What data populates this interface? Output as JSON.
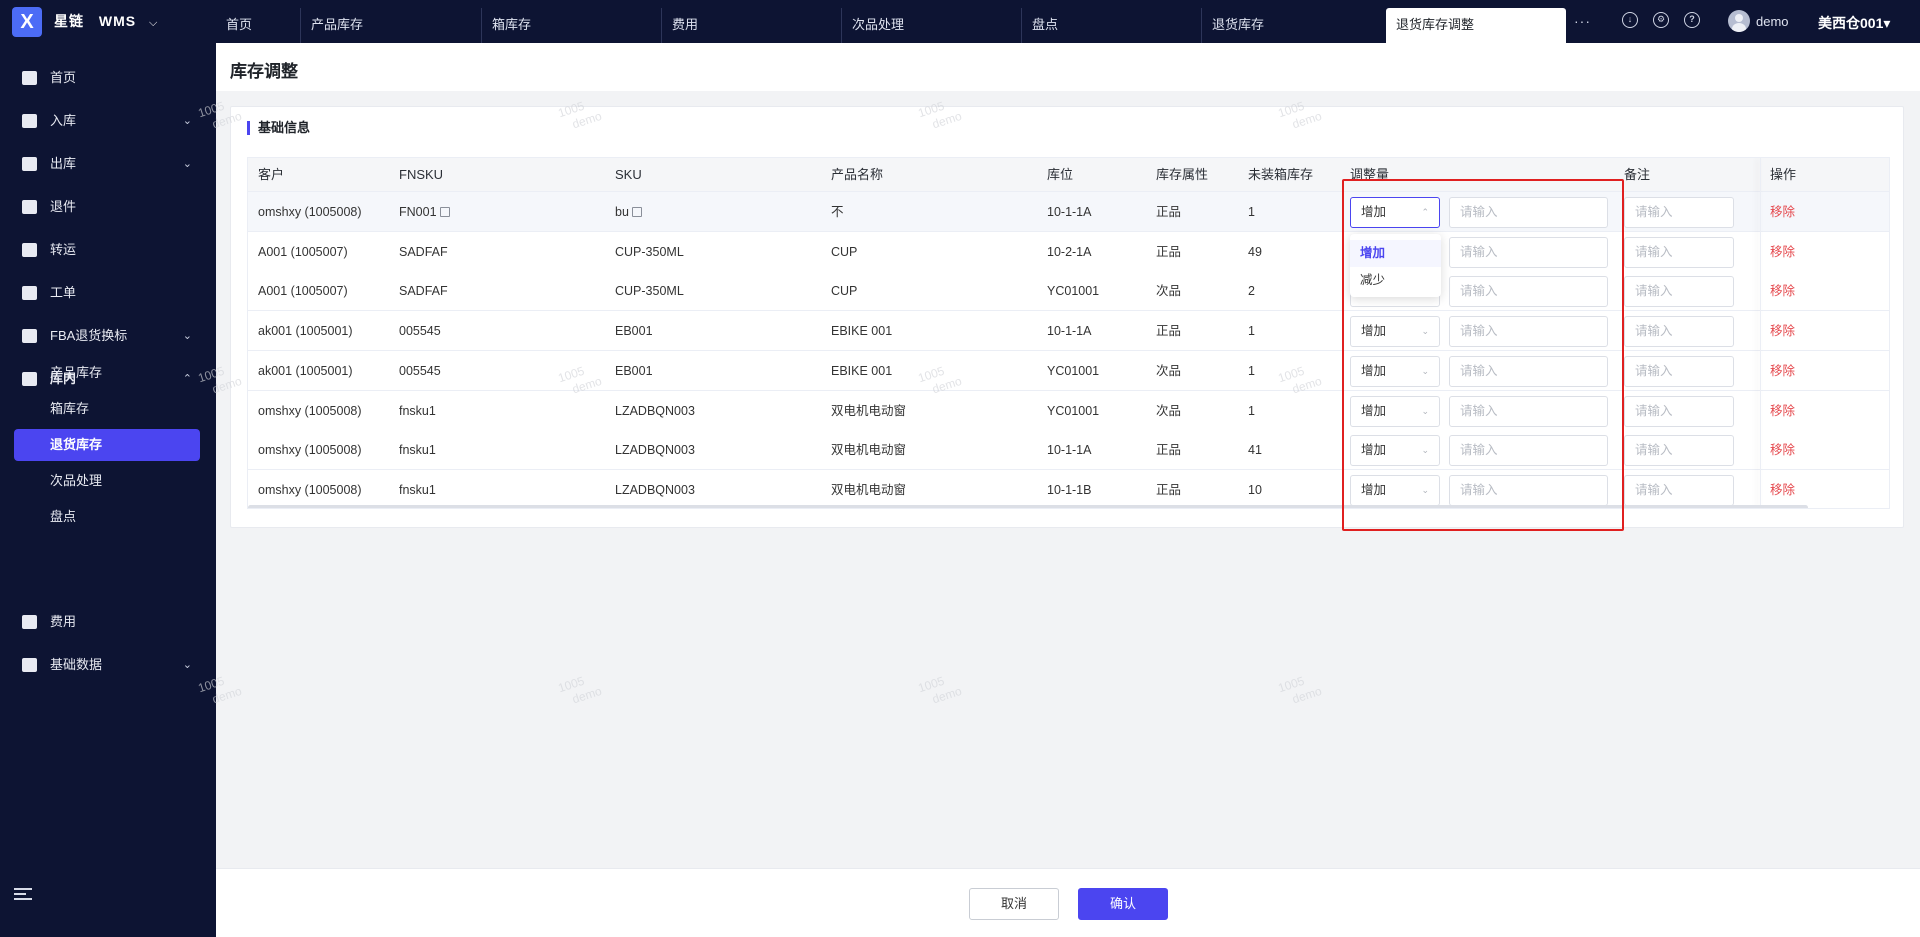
{
  "app": {
    "brand": "星链",
    "product": "WMS",
    "chevron": "⌵",
    "user": "demo",
    "warehouse": "美西仓001▾",
    "more": "···"
  },
  "tabs": [
    {
      "label": "首页"
    },
    {
      "label": "产品库存"
    },
    {
      "label": "箱库存"
    },
    {
      "label": "费用"
    },
    {
      "label": "次品处理"
    },
    {
      "label": "盘点"
    },
    {
      "label": "退货库存"
    },
    {
      "label": "退货库存调整"
    }
  ],
  "sidebar": {
    "items": [
      {
        "label": "首页",
        "arrow": ""
      },
      {
        "label": "入库",
        "arrow": "⌄"
      },
      {
        "label": "出库",
        "arrow": "⌄"
      },
      {
        "label": "退件",
        "arrow": ""
      },
      {
        "label": "转运",
        "arrow": ""
      },
      {
        "label": "工单",
        "arrow": ""
      },
      {
        "label": "FBA退货换标",
        "arrow": "⌄"
      },
      {
        "label": "库内",
        "arrow": "⌃"
      },
      {
        "label": "费用",
        "arrow": ""
      },
      {
        "label": "基础数据",
        "arrow": "⌄"
      }
    ],
    "sub_items": [
      {
        "label": "产品库存"
      },
      {
        "label": "箱库存"
      },
      {
        "label": "退货库存"
      },
      {
        "label": "次品处理"
      },
      {
        "label": "盘点"
      }
    ]
  },
  "page": {
    "title": "库存调整",
    "section_title": "基础信息"
  },
  "table": {
    "headers": [
      "客户",
      "FNSKU",
      "SKU",
      "产品名称",
      "库位",
      "库存属性",
      "未装箱库存",
      "调整量",
      "备注",
      "操作"
    ],
    "rows": [
      {
        "customer": "omshxy (1005008)",
        "fnsku": "FN001",
        "sku": "bu",
        "name": "不",
        "location": "10-1-1A",
        "attr": "正品",
        "stock": "1",
        "adjust": "增加",
        "qty_placeholder": "请输入",
        "note_placeholder": "请输入",
        "action": "移除"
      },
      {
        "customer": "A001 (1005007)",
        "fnsku": "SADFAF",
        "sku": "CUP-350ML",
        "name": "CUP",
        "location": "10-2-1A",
        "attr": "正品",
        "stock": "49",
        "adjust": "增加",
        "qty_placeholder": "请输入",
        "note_placeholder": "请输入",
        "action": "移除"
      },
      {
        "customer": "A001 (1005007)",
        "fnsku": "SADFAF",
        "sku": "CUP-350ML",
        "name": "CUP",
        "location": "YC01001",
        "attr": "次品",
        "stock": "2",
        "adjust": "增加",
        "qty_placeholder": "请输入",
        "note_placeholder": "请输入",
        "action": "移除"
      },
      {
        "customer": "ak001 (1005001)",
        "fnsku": "005545",
        "sku": "EB001",
        "name": "EBIKE 001",
        "location": "10-1-1A",
        "attr": "正品",
        "stock": "1",
        "adjust": "增加",
        "qty_placeholder": "请输入",
        "note_placeholder": "请输入",
        "action": "移除"
      },
      {
        "customer": "ak001 (1005001)",
        "fnsku": "005545",
        "sku": "EB001",
        "name": "EBIKE 001",
        "location": "YC01001",
        "attr": "次品",
        "stock": "1",
        "adjust": "增加",
        "qty_placeholder": "请输入",
        "note_placeholder": "请输入",
        "action": "移除"
      },
      {
        "customer": "omshxy (1005008)",
        "fnsku": "fnsku1",
        "sku": "LZADBQN003",
        "name": "双电机电动窗",
        "location": "YC01001",
        "attr": "次品",
        "stock": "1",
        "adjust": "增加",
        "qty_placeholder": "请输入",
        "note_placeholder": "请输入",
        "action": "移除"
      },
      {
        "customer": "omshxy (1005008)",
        "fnsku": "fnsku1",
        "sku": "LZADBQN003",
        "name": "双电机电动窗",
        "location": "10-1-1A",
        "attr": "正品",
        "stock": "41",
        "adjust": "增加",
        "qty_placeholder": "请输入",
        "note_placeholder": "请输入",
        "action": "移除"
      },
      {
        "customer": "omshxy (1005008)",
        "fnsku": "fnsku1",
        "sku": "LZADBQN003",
        "name": "双电机电动窗",
        "location": "10-1-1B",
        "attr": "正品",
        "stock": "10",
        "adjust": "增加",
        "qty_placeholder": "请输入",
        "note_placeholder": "请输入",
        "action": "移除"
      }
    ]
  },
  "dropdown": {
    "options": [
      {
        "label": "增加",
        "selected": true
      },
      {
        "label": "减少",
        "selected": false
      }
    ]
  },
  "footer": {
    "cancel": "取消",
    "confirm": "确认"
  },
  "watermark": {
    "line1": "1005",
    "line2": "demo"
  },
  "colors": {
    "primary": "#4b45f0",
    "nav_bg": "#0d1433",
    "danger": "#e5484d",
    "highlight_box": "#e02020"
  }
}
